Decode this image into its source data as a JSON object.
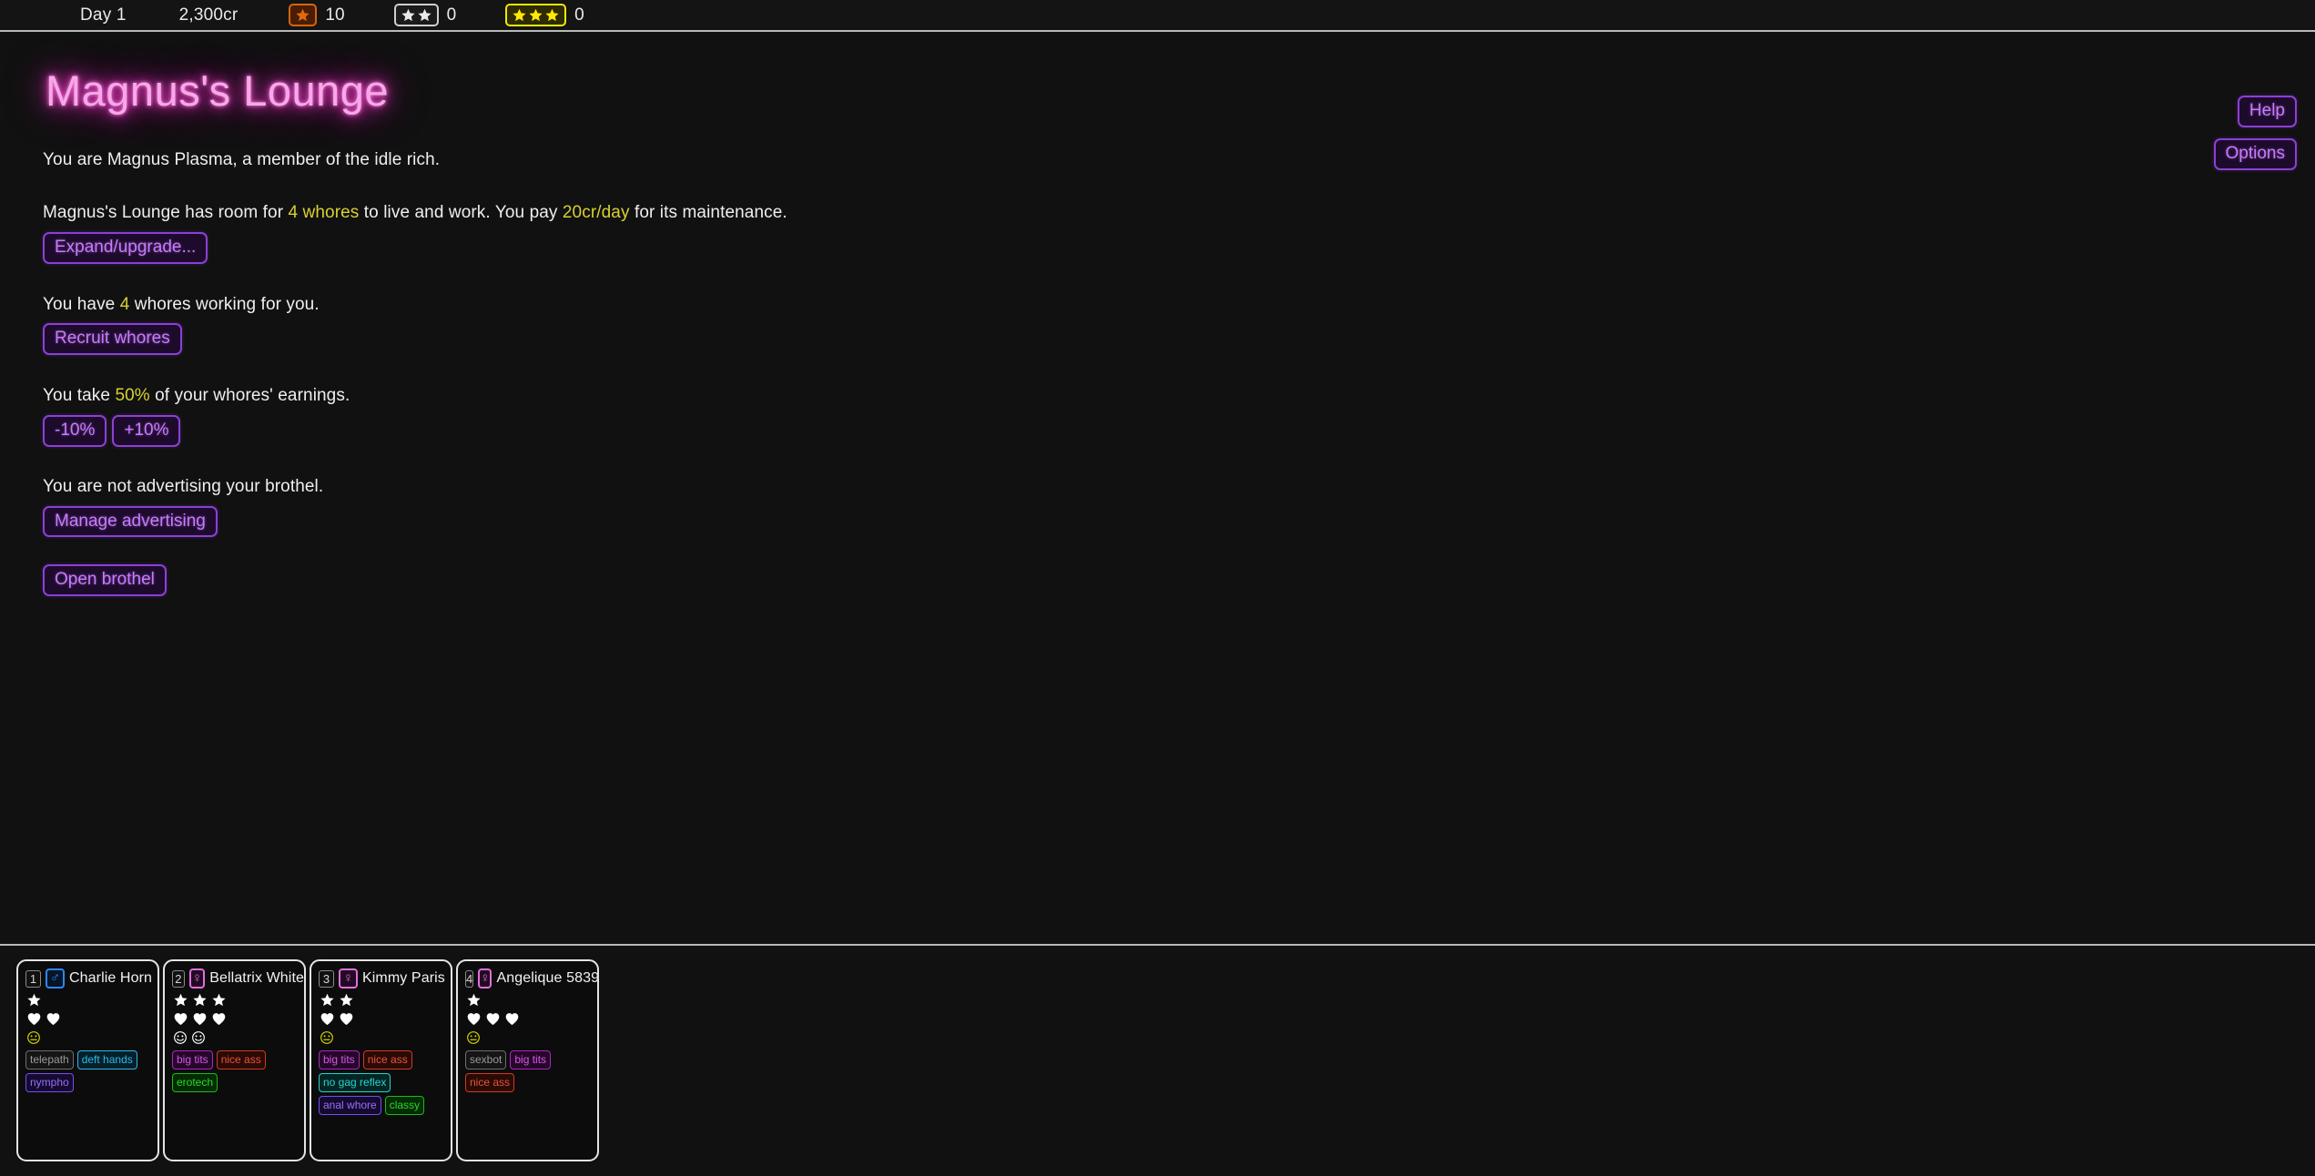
{
  "topbar": {
    "day": "Day 1",
    "money": "2,300cr",
    "counters": [
      {
        "icon": "one-star-badge-icon",
        "stars": 1,
        "style": "badge-1",
        "value": "10"
      },
      {
        "icon": "two-star-badge-icon",
        "stars": 2,
        "style": "badge-2",
        "value": "0"
      },
      {
        "icon": "three-star-badge-icon",
        "stars": 3,
        "style": "badge-3",
        "value": "0"
      }
    ]
  },
  "corner": {
    "help_label": "Help",
    "options_label": "Options"
  },
  "page": {
    "title": "Magnus's Lounge",
    "intro": "You are Magnus Plasma, a member of the idle rich.",
    "capacity": {
      "pre": "Magnus's Lounge has room for ",
      "rooms": "4 whores",
      "mid": " to live and work. You pay ",
      "upkeep": "20cr/day",
      "post": " for its maintenance.",
      "button": "Expand/upgrade..."
    },
    "staff": {
      "pre": "You have ",
      "count": "4",
      "post": " whores working for you.",
      "button": "Recruit whores"
    },
    "cut": {
      "pre": "You take ",
      "percent": "50%",
      "post": " of your whores' earnings.",
      "button_down": "-10%",
      "button_up": "+10%"
    },
    "advertising": {
      "text": "You are not advertising your brothel.",
      "button": "Manage advertising"
    },
    "open_button": "Open brothel"
  },
  "colors": {
    "accent_purple": "#8c3fd6",
    "button_text": "#c77bff",
    "highlight_yellow": "#d8d032",
    "title_neon": "#f7a8e8",
    "background": "#111111"
  },
  "roster": [
    {
      "slot": "1",
      "gender": "male",
      "gender_glyph": "♂",
      "name": "Charlie Horn",
      "stars": 1,
      "hearts": 2,
      "moods": [
        {
          "type": "neutral",
          "color": "#d4d400"
        }
      ],
      "tags": [
        {
          "label": "telepath",
          "style": "tag-gray"
        },
        {
          "label": "deft hands",
          "style": "tag-cyan"
        },
        {
          "label": "nympho",
          "style": "tag-violet"
        }
      ]
    },
    {
      "slot": "2",
      "gender": "female",
      "gender_glyph": "♀",
      "name": "Bellatrix White",
      "stars": 3,
      "hearts": 3,
      "moods": [
        {
          "type": "happy",
          "color": "#ffffff"
        },
        {
          "type": "happy",
          "color": "#ffffff"
        }
      ],
      "tags": [
        {
          "label": "big tits",
          "style": "tag-purple"
        },
        {
          "label": "nice ass",
          "style": "tag-red"
        },
        {
          "label": "erotech",
          "style": "tag-green"
        }
      ]
    },
    {
      "slot": "3",
      "gender": "female",
      "gender_glyph": "♀",
      "name": "Kimmy Paris",
      "stars": 2,
      "hearts": 2,
      "moods": [
        {
          "type": "neutral",
          "color": "#d4d400"
        }
      ],
      "tags": [
        {
          "label": "big tits",
          "style": "tag-purple"
        },
        {
          "label": "nice ass",
          "style": "tag-red"
        },
        {
          "label": "no gag reflex",
          "style": "tag-teal"
        },
        {
          "label": "anal whore",
          "style": "tag-violet"
        },
        {
          "label": "classy",
          "style": "tag-green"
        }
      ]
    },
    {
      "slot": "4",
      "gender": "female",
      "gender_glyph": "♀",
      "name": "Angelique 5839",
      "stars": 1,
      "hearts": 3,
      "moods": [
        {
          "type": "neutral",
          "color": "#d4d400"
        }
      ],
      "tags": [
        {
          "label": "sexbot",
          "style": "tag-gray"
        },
        {
          "label": "big tits",
          "style": "tag-purple"
        },
        {
          "label": "nice ass",
          "style": "tag-red"
        }
      ]
    }
  ]
}
